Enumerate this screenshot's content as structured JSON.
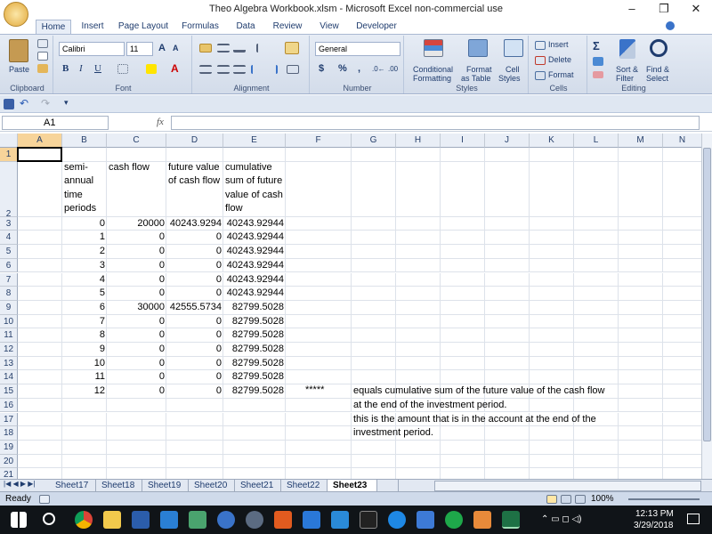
{
  "window": {
    "title": "Theo Algebra Workbook.xlsm - Microsoft Excel non-commercial use"
  },
  "ribbon": {
    "tabs": [
      "Home",
      "Insert",
      "Page Layout",
      "Formulas",
      "Data",
      "Review",
      "View",
      "Developer"
    ],
    "clipboard": {
      "label": "Clipboard",
      "paste": "Paste"
    },
    "font": {
      "label": "Font",
      "name": "Calibri",
      "size": "11"
    },
    "alignment": {
      "label": "Alignment"
    },
    "number": {
      "label": "Number",
      "format": "General"
    },
    "styles": {
      "label": "Styles",
      "conditional": "Conditional",
      "conditional2": "Formatting",
      "format_table": "Format",
      "format_table2": "as Table",
      "cell_styles": "Cell",
      "cell_styles2": "Styles"
    },
    "cells": {
      "label": "Cells",
      "insert": "Insert",
      "delete": "Delete",
      "format": "Format"
    },
    "editing": {
      "label": "Editing",
      "sort": "Sort &",
      "sort2": "Filter",
      "find": "Find &",
      "find2": "Select"
    }
  },
  "formula_bar": {
    "name_box": "A1",
    "fx": "fx",
    "formula": ""
  },
  "columns": [
    "A",
    "B",
    "C",
    "D",
    "E",
    "F",
    "G",
    "H",
    "I",
    "J",
    "K",
    "L",
    "M",
    "N"
  ],
  "rows": [
    "1",
    "2",
    "3",
    "4",
    "5",
    "6",
    "7",
    "8",
    "9",
    "10",
    "11",
    "12",
    "13",
    "14",
    "15",
    "16",
    "17",
    "18",
    "19",
    "20",
    "21"
  ],
  "headers": {
    "b2": [
      "semi-",
      "annual",
      "time",
      "periods"
    ],
    "c2": [
      "cash flow"
    ],
    "d2": [
      "future value",
      "of cash flow"
    ],
    "e2": [
      "cumulative",
      "sum of future",
      "value of cash",
      "flow"
    ]
  },
  "table": [
    {
      "b": "0",
      "c": "20000",
      "d": "40243.9294",
      "e": "40243.92944"
    },
    {
      "b": "1",
      "c": "0",
      "d": "0",
      "e": "40243.92944"
    },
    {
      "b": "2",
      "c": "0",
      "d": "0",
      "e": "40243.92944"
    },
    {
      "b": "3",
      "c": "0",
      "d": "0",
      "e": "40243.92944"
    },
    {
      "b": "4",
      "c": "0",
      "d": "0",
      "e": "40243.92944"
    },
    {
      "b": "5",
      "c": "0",
      "d": "0",
      "e": "40243.92944"
    },
    {
      "b": "6",
      "c": "30000",
      "d": "42555.5734",
      "e": "82799.5028"
    },
    {
      "b": "7",
      "c": "0",
      "d": "0",
      "e": "82799.5028"
    },
    {
      "b": "8",
      "c": "0",
      "d": "0",
      "e": "82799.5028"
    },
    {
      "b": "9",
      "c": "0",
      "d": "0",
      "e": "82799.5028"
    },
    {
      "b": "10",
      "c": "0",
      "d": "0",
      "e": "82799.5028"
    },
    {
      "b": "11",
      "c": "0",
      "d": "0",
      "e": "82799.5028"
    },
    {
      "b": "12",
      "c": "0",
      "d": "0",
      "e": "82799.5028"
    }
  ],
  "notes": {
    "f15": "*****",
    "g15": "equals cumulative sum of the future value of the cash flow",
    "g16": "at the end of the investment period.",
    "g17": "this is the amount that is in the account at the end of the",
    "g18": "investment period."
  },
  "sheets": [
    "Sheet17",
    "Sheet18",
    "Sheet19",
    "Sheet20",
    "Sheet21",
    "Sheet22",
    "Sheet23"
  ],
  "active_sheet": "Sheet23",
  "status": {
    "mode": "Ready",
    "zoom": "100%"
  },
  "taskbar": {
    "time": "12:13 PM",
    "date": "3/29/2018"
  }
}
